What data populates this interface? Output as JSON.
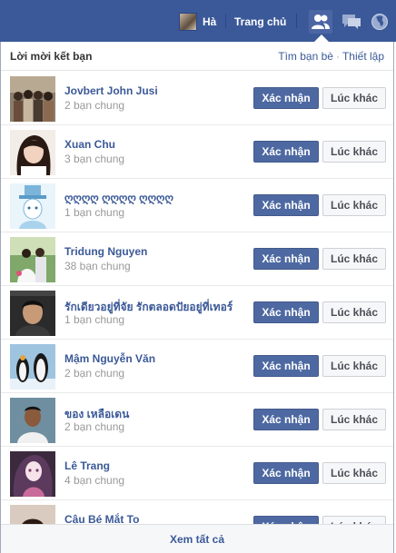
{
  "topbar": {
    "user_name": "Hà",
    "home_label": "Trang chủ",
    "icons": [
      "friend-requests-icon",
      "messages-icon",
      "notifications-globe-icon"
    ]
  },
  "panel": {
    "title": "Lời mời kết bạn",
    "find_friends_link": "Tìm bạn bè",
    "separator": "·",
    "settings_link": "Thiết lập",
    "see_all": "Xem tất cả"
  },
  "requests": [
    {
      "name": "Jovbert John Jusi",
      "mutual": "2 bạn chung",
      "confirm": "Xác nhận",
      "later": "Lúc khác"
    },
    {
      "name": "Xuan Chu",
      "mutual": "3 bạn chung",
      "confirm": "Xác nhận",
      "later": "Lúc khác"
    },
    {
      "name": "ღღღღ ღღღღ ღღღღ",
      "mutual": "1 bạn chung",
      "confirm": "Xác nhận",
      "later": "Lúc khác"
    },
    {
      "name": "Tridung Nguyen",
      "mutual": "38 bạn chung",
      "confirm": "Xác nhận",
      "later": "Lúc khác"
    },
    {
      "name": "รักเดียวอยู่ที่จัย รักตลอดปัยอยู่ที่เทอร์",
      "mutual": "1 bạn chung",
      "confirm": "Xác nhận",
      "later": "Lúc khác"
    },
    {
      "name": "Mậm Nguyễn Văn",
      "mutual": "2 bạn chung",
      "confirm": "Xác nhận",
      "later": "Lúc khác"
    },
    {
      "name": "ของ เหลือเดน",
      "mutual": "2 bạn chung",
      "confirm": "Xác nhận",
      "later": "Lúc khác"
    },
    {
      "name": "Lê Trang",
      "mutual": "4 bạn chung",
      "confirm": "Xác nhận",
      "later": "Lúc khác"
    },
    {
      "name": "Cậu Bé Mắt To",
      "mutual": "",
      "confirm": "Xác nhận",
      "later": "Lúc khác"
    }
  ],
  "colors": {
    "brand_blue": "#3b5998",
    "confirm_button": "#4e69a2",
    "muted_text": "#999999"
  }
}
